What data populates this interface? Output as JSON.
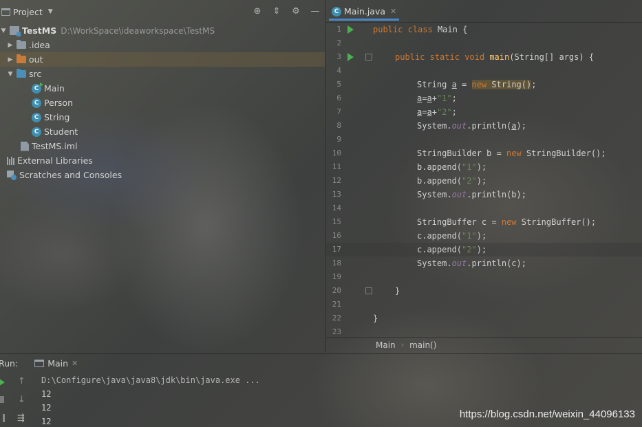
{
  "project_panel": {
    "title": "Project",
    "tree": [
      {
        "label": "TestMS",
        "path": "D:\\WorkSpace\\ideaworkspace\\TestMS"
      },
      {
        "label": ".idea"
      },
      {
        "label": "out"
      },
      {
        "label": "src"
      },
      {
        "label": "Main"
      },
      {
        "label": "Person"
      },
      {
        "label": "String"
      },
      {
        "label": "Student"
      },
      {
        "label": "TestMS.iml"
      },
      {
        "label": "External Libraries"
      },
      {
        "label": "Scratches and Consoles"
      }
    ]
  },
  "editor": {
    "tab_label": "Main.java",
    "class_icon_letter": "C",
    "breadcrumb": [
      "Main",
      "main()"
    ],
    "line_numbers": [
      "1",
      "2",
      "3",
      "4",
      "5",
      "6",
      "7",
      "8",
      "9",
      "10",
      "11",
      "12",
      "13",
      "14",
      "15",
      "16",
      "17",
      "18",
      "19",
      "20",
      "21",
      "22",
      "23"
    ],
    "code": {
      "l1": {
        "kw1": "public",
        "kw2": "class",
        "rest": "Main {"
      },
      "l3": {
        "kw1": "public",
        "kw2": "static",
        "kw3": "void",
        "fn": "main",
        "rest": "(String[] args) {"
      },
      "l5": {
        "type": "String",
        "var": "a",
        "eq": " = ",
        "kw": "new",
        "rest": " String()",
        "end": ";"
      },
      "l6": {
        "var": "a",
        "mid": "=",
        "var2": "a",
        "op": "+",
        "str": "\"1\"",
        "end": ";"
      },
      "l7": {
        "var": "a",
        "mid": "=",
        "var2": "a",
        "op": "+",
        "str": "\"2\"",
        "end": ";"
      },
      "l8": {
        "pre": "System.",
        "fld": "out",
        "mid": ".println(",
        "var": "a",
        "end": ");"
      },
      "l10": {
        "pre": "StringBuilder b = ",
        "kw": "new",
        "rest": " StringBuilder();"
      },
      "l11": {
        "pre": "b.append(",
        "str": "\"1\"",
        "end": ");"
      },
      "l12": {
        "pre": "b.append(",
        "str": "\"2\"",
        "end": ");"
      },
      "l13": {
        "pre": "System.",
        "fld": "out",
        "end": ".println(b);"
      },
      "l15": {
        "pre": "StringBuffer c = ",
        "kw": "new",
        "rest": " StringBuffer();"
      },
      "l16": {
        "pre": "c.append(",
        "str": "\"1\"",
        "end": ");"
      },
      "l17": {
        "pre": "c.append(",
        "str": "\"2\"",
        "end": ");"
      },
      "l18": {
        "pre": "System.",
        "fld": "out",
        "end": ".println(c);"
      },
      "l20": {
        "text": "}"
      },
      "l22": {
        "text": "}"
      }
    }
  },
  "run_panel": {
    "title": "Run:",
    "tab_label": "Main",
    "console": [
      "D:\\Configure\\java\\java8\\jdk\\bin\\java.exe ...",
      "12",
      "12",
      "12"
    ]
  },
  "watermark": "https://blog.csdn.net/weixin_44096133",
  "colors": {
    "keyword": "#cc7832",
    "string": "#6a8759",
    "function": "#ffc66d",
    "field": "#9876aa",
    "tab_underline": "#4a88c7",
    "run_green": "#4caf50"
  },
  "icons": [
    "project-icon",
    "chevron-down-icon",
    "locate-icon",
    "collapse-icon",
    "gear-icon",
    "minimize-icon",
    "folder-icon",
    "class-icon",
    "file-icon",
    "library-icon",
    "scratch-icon",
    "run-icon",
    "fold-icon",
    "console-icon",
    "close-icon",
    "play-icon",
    "stop-icon",
    "pause-icon",
    "up-arrow-icon",
    "down-arrow-icon",
    "soft-wrap-icon"
  ]
}
